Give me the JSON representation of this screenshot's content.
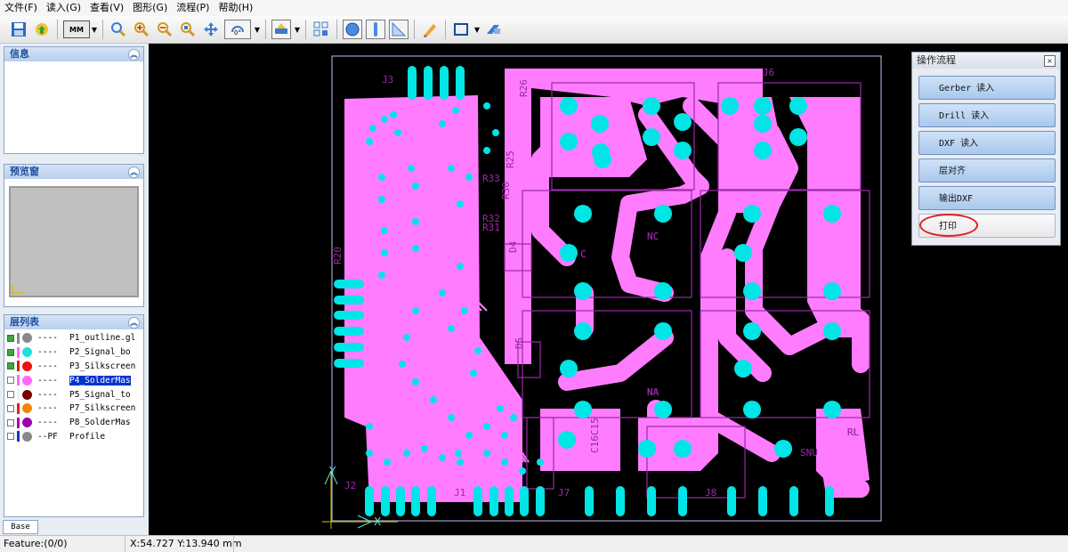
{
  "menu": [
    "文件(F)",
    "读入(G)",
    "查看(V)",
    "图形(G)",
    "流程(P)",
    "帮助(H)"
  ],
  "toolbar": {
    "unit": "MM",
    "icons": [
      "save-icon",
      "load-icon",
      "unit-select",
      "zoom-icon",
      "zoom-in-icon",
      "zoom-out-icon",
      "zoom-fit-icon",
      "pan-icon",
      "rotate-icon",
      "layer-color-icon",
      "layer-select-icon",
      "circle-shape-icon",
      "line-shape-icon",
      "corner-icon",
      "pencil-icon",
      "rectangle-icon",
      "export-icon"
    ],
    "rotate_label": "0°"
  },
  "panels": {
    "info_title": "信息",
    "preview_title": "预览窗",
    "layers_title": "层列表",
    "collapse_glyph": "︽"
  },
  "layers": [
    {
      "checked": true,
      "bar": "#888888",
      "dot": "#888888",
      "dash": "----",
      "name": "P1_outline.gl"
    },
    {
      "checked": true,
      "bar": "#ff66ff",
      "dot": "#22dddd",
      "dash": "----",
      "name": "P2_Signal_bo"
    },
    {
      "checked": true,
      "bar": "#ee1111",
      "dot": "#ee1111",
      "dash": "----",
      "name": "P3_Silkscreen"
    },
    {
      "checked": false,
      "bar": "#ff66ff",
      "dot": "#ff66ff",
      "dash": "----",
      "name": "P4_SolderMas",
      "selected": true
    },
    {
      "checked": false,
      "bar": "#f0f0f0",
      "dot": "#7a0000",
      "dash": "----",
      "name": "P5_Signal_to"
    },
    {
      "checked": false,
      "bar": "#dd2222",
      "dot": "#ee8800",
      "dash": "----",
      "name": "P7_Silkscreen"
    },
    {
      "checked": false,
      "bar": "#aa00aa",
      "dot": "#9900aa",
      "dash": "----",
      "name": "P8_SolderMas"
    },
    {
      "checked": false,
      "bar": "#1133cc",
      "dot": "#888888",
      "dash": "--PF",
      "name": "Profile"
    }
  ],
  "tab": "Base",
  "status": {
    "feature": "Feature:(0/0)",
    "coords": "X:54.727 Y:13.940 mm"
  },
  "opwin": {
    "title": "操作流程",
    "close": "×",
    "buttons": [
      "Gerber 读入",
      "Drill 读入",
      "DXF 读入",
      "层对齐",
      "输出DXF",
      "打印"
    ]
  },
  "pcb": {
    "labels": [
      "J3",
      "J2",
      "J1",
      "J7",
      "J8",
      "NC",
      "NC",
      "NA",
      "NA",
      "NA",
      "NA",
      "RL",
      "RL",
      "RL",
      "SNU",
      "R20",
      "C16C15",
      "D4",
      "D5",
      "R25",
      "R26",
      "R30",
      "R31",
      "R32",
      "R33",
      "C",
      "C",
      "C",
      "J6"
    ],
    "axis": {
      "x": "X",
      "y": "Y"
    }
  },
  "colors": {
    "trace": "#ff7cff",
    "pad": "#00e5e5",
    "silk": "#9a2aa8",
    "board": "#000000",
    "outline": "#9aa2c8"
  }
}
